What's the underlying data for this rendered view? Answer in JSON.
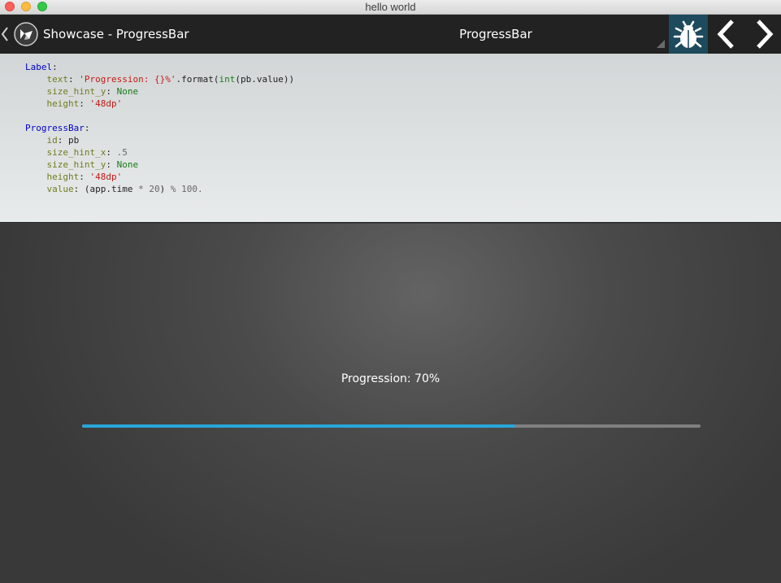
{
  "window": {
    "title": "hello world"
  },
  "actionbar": {
    "app_title": "Showcase - ProgressBar",
    "spinner_value": "ProgressBar",
    "icons": {
      "back": "chevron-left-icon",
      "logo": "kivy-logo-icon",
      "bug": "bug-icon",
      "prev": "chevron-left-icon",
      "next": "chevron-right-icon"
    }
  },
  "code": {
    "lines": [
      [
        {
          "t": "Label",
          "c": "class"
        },
        {
          "t": ":",
          "c": "plain"
        }
      ],
      [
        {
          "t": "    ",
          "c": "plain"
        },
        {
          "t": "text",
          "c": "prop"
        },
        {
          "t": ": ",
          "c": "plain"
        },
        {
          "t": "'Progression: {}%'",
          "c": "str"
        },
        {
          "t": ".format(",
          "c": "plain"
        },
        {
          "t": "int",
          "c": "func"
        },
        {
          "t": "(pb.value))",
          "c": "plain"
        }
      ],
      [
        {
          "t": "    ",
          "c": "plain"
        },
        {
          "t": "size_hint_y",
          "c": "prop"
        },
        {
          "t": ": ",
          "c": "plain"
        },
        {
          "t": "None",
          "c": "kw"
        }
      ],
      [
        {
          "t": "    ",
          "c": "plain"
        },
        {
          "t": "height",
          "c": "prop"
        },
        {
          "t": ": ",
          "c": "plain"
        },
        {
          "t": "'48dp'",
          "c": "str"
        }
      ],
      [],
      [
        {
          "t": "ProgressBar",
          "c": "class"
        },
        {
          "t": ":",
          "c": "plain"
        }
      ],
      [
        {
          "t": "    ",
          "c": "plain"
        },
        {
          "t": "id",
          "c": "prop"
        },
        {
          "t": ": pb",
          "c": "plain"
        }
      ],
      [
        {
          "t": "    ",
          "c": "plain"
        },
        {
          "t": "size_hint_x",
          "c": "prop"
        },
        {
          "t": ": ",
          "c": "plain"
        },
        {
          "t": ".5",
          "c": "num"
        }
      ],
      [
        {
          "t": "    ",
          "c": "plain"
        },
        {
          "t": "size_hint_y",
          "c": "prop"
        },
        {
          "t": ": ",
          "c": "plain"
        },
        {
          "t": "None",
          "c": "kw"
        }
      ],
      [
        {
          "t": "    ",
          "c": "plain"
        },
        {
          "t": "height",
          "c": "prop"
        },
        {
          "t": ": ",
          "c": "plain"
        },
        {
          "t": "'48dp'",
          "c": "str"
        }
      ],
      [
        {
          "t": "    ",
          "c": "plain"
        },
        {
          "t": "value",
          "c": "prop"
        },
        {
          "t": ": (app.time ",
          "c": "plain"
        },
        {
          "t": "*",
          "c": "op"
        },
        {
          "t": " ",
          "c": "plain"
        },
        {
          "t": "20",
          "c": "num"
        },
        {
          "t": ") ",
          "c": "plain"
        },
        {
          "t": "%",
          "c": "op"
        },
        {
          "t": " ",
          "c": "plain"
        },
        {
          "t": "100.",
          "c": "num"
        }
      ]
    ]
  },
  "progress": {
    "label": "Progression: 70%",
    "value_percent": 70,
    "fill_color": "#2aa6d8",
    "track_color": "#808080"
  }
}
